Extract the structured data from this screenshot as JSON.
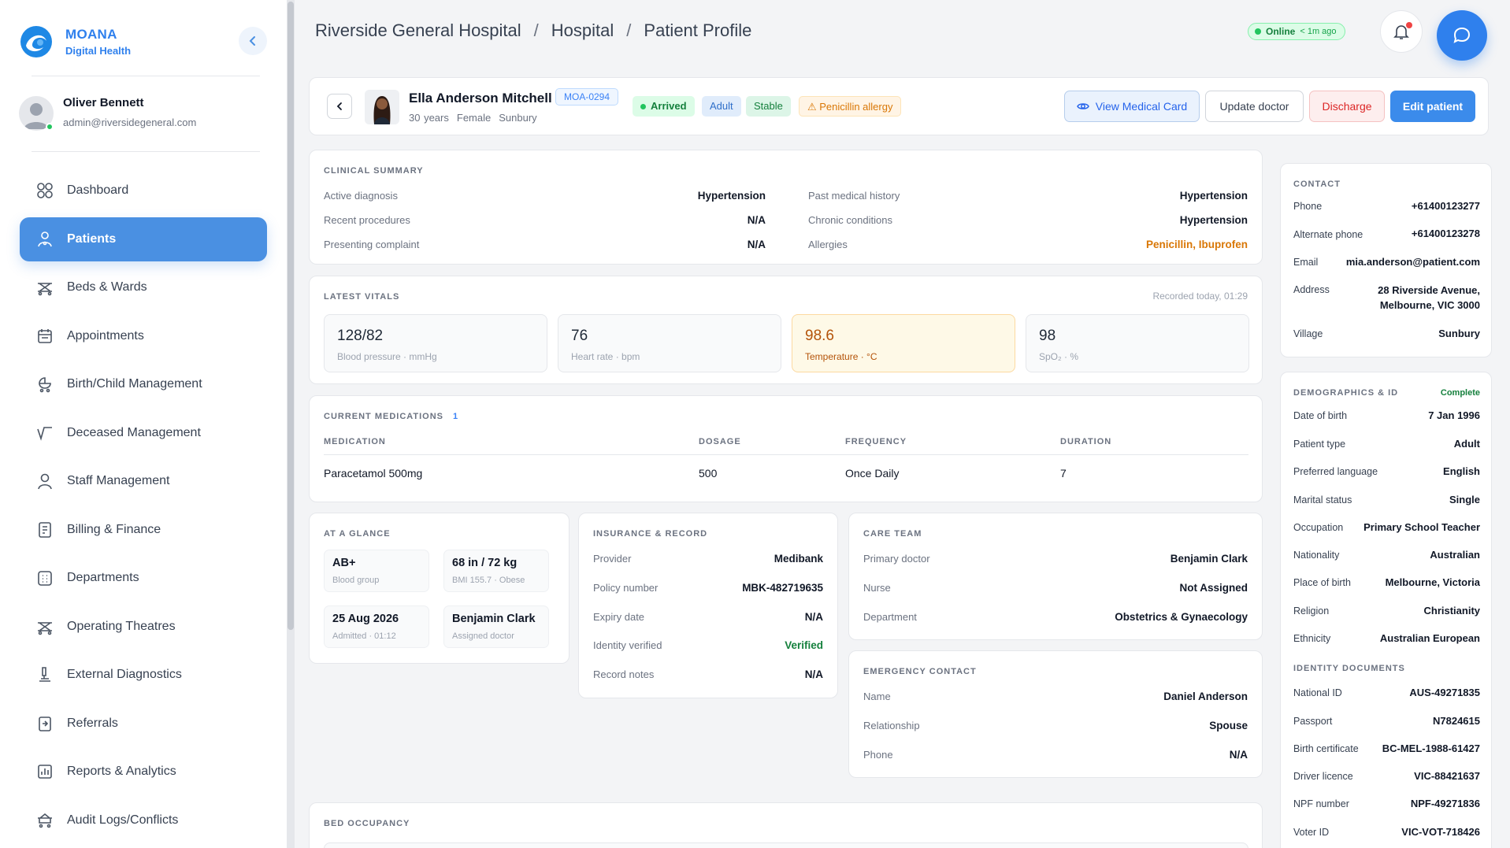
{
  "brand": {
    "name": "MOANA",
    "subtitle": "Digital Health"
  },
  "user": {
    "name": "Oliver Bennett",
    "email": "admin@riversidegeneral.com"
  },
  "nav": [
    {
      "label": "Dashboard",
      "icon": "dashboard-icon"
    },
    {
      "label": "Patients",
      "icon": "patients-icon",
      "active": true
    },
    {
      "label": "Beds & Wards",
      "icon": "bed-icon"
    },
    {
      "label": "Appointments",
      "icon": "calendar-icon"
    },
    {
      "label": "Birth/Child Management",
      "icon": "stroller-icon"
    },
    {
      "label": "Deceased Management",
      "icon": "pulse-icon"
    },
    {
      "label": "Staff Management",
      "icon": "staff-icon"
    },
    {
      "label": "Billing & Finance",
      "icon": "billing-icon"
    },
    {
      "label": "Departments",
      "icon": "building-icon"
    },
    {
      "label": "Operating Theatres",
      "icon": "theatre-icon"
    },
    {
      "label": "External Diagnostics",
      "icon": "microscope-icon"
    },
    {
      "label": "Referrals",
      "icon": "referral-icon"
    },
    {
      "label": "Reports & Analytics",
      "icon": "chart-icon"
    },
    {
      "label": "Audit Logs/Conflicts",
      "icon": "audit-icon"
    }
  ],
  "breadcrumb": [
    "Riverside General Hospital",
    "Hospital",
    "Patient Profile"
  ],
  "status": {
    "label": "Online",
    "ago": "< 1m ago"
  },
  "patient": {
    "name": "Ella Anderson Mitchell",
    "id": "MOA-0294",
    "age": "30 years",
    "sex": "Female",
    "village": "Sunbury",
    "tags": {
      "arrived": "Arrived",
      "type": "Adult",
      "condition": "Stable",
      "allergy": "⚠ Penicillin allergy"
    }
  },
  "actions": {
    "view": "View Medical Card",
    "update": "Update doctor",
    "discharge": "Discharge",
    "edit": "Edit patient"
  },
  "clinical": {
    "title": "CLINICAL SUMMARY",
    "rows": [
      {
        "label": "Active diagnosis",
        "value": "Hypertension"
      },
      {
        "label": "Recent procedures",
        "value": "N/A"
      },
      {
        "label": "Presenting complaint",
        "value": "N/A"
      },
      {
        "label": "Past medical history",
        "value": "Hypertension"
      },
      {
        "label": "Chronic conditions",
        "value": "Hypertension"
      },
      {
        "label": "Allergies",
        "value": "Penicillin, Ibuprofen"
      }
    ]
  },
  "vitals": {
    "title": "LATEST VITALS",
    "recorded": "Recorded today, 01:29",
    "items": [
      {
        "value": "128/82",
        "label": "Blood pressure · mmHg"
      },
      {
        "value": "76",
        "label": "Heart rate · bpm"
      },
      {
        "value": "98.6",
        "label": "Temperature · °C"
      },
      {
        "value": "98",
        "label": "SpO₂ · %"
      }
    ]
  },
  "medications": {
    "title": "CURRENT MEDICATIONS",
    "count": "1",
    "headers": [
      "MEDICATION",
      "DOSAGE",
      "FREQUENCY",
      "DURATION"
    ],
    "rows": [
      [
        "Paracetamol 500mg",
        "500",
        "Once Daily",
        "7"
      ]
    ]
  },
  "glance": {
    "title": "AT A GLANCE",
    "tiles": [
      {
        "value": "AB+",
        "label": "Blood group"
      },
      {
        "value": "68 in / 72 kg",
        "label": "BMI 155.7 · Obese"
      },
      {
        "value": "25 Aug 2026",
        "label": "Admitted · 01:12"
      },
      {
        "value": "Benjamin Clark",
        "label": "Assigned doctor"
      }
    ]
  },
  "insurance": {
    "title": "INSURANCE & RECORD",
    "rows": [
      {
        "label": "Provider",
        "value": "Medibank"
      },
      {
        "label": "Policy number",
        "value": "MBK-482719635"
      },
      {
        "label": "Expiry date",
        "value": "N/A"
      },
      {
        "label": "Identity verified",
        "value": "Verified"
      },
      {
        "label": "Record notes",
        "value": "N/A"
      }
    ]
  },
  "care": {
    "title": "CARE TEAM",
    "rows": [
      {
        "label": "Primary doctor",
        "value": "Benjamin Clark"
      },
      {
        "label": "Nurse",
        "value": "Not Assigned"
      },
      {
        "label": "Department",
        "value": "Obstetrics & Gynaecology"
      }
    ]
  },
  "emergency": {
    "title": "EMERGENCY CONTACT",
    "rows": [
      {
        "label": "Name",
        "value": "Daniel Anderson"
      },
      {
        "label": "Relationship",
        "value": "Spouse"
      },
      {
        "label": "Phone",
        "value": "N/A"
      }
    ]
  },
  "bed": {
    "title": "BED OCCUPANCY"
  },
  "contact": {
    "title": "CONTACT",
    "rows": [
      {
        "label": "Phone",
        "value": "+61400123277"
      },
      {
        "label": "Alternate phone",
        "value": "+61400123278"
      },
      {
        "label": "Email",
        "value": "mia.anderson@patient.com"
      },
      {
        "label": "Address",
        "value": "28 Riverside Avenue,",
        "value2": "Melbourne, VIC 3000"
      },
      {
        "label": "Village",
        "value": "Sunbury"
      }
    ]
  },
  "demographics": {
    "title": "DEMOGRAPHICS & ID",
    "status": "Complete",
    "rows": [
      {
        "label": "Date of birth",
        "value": "7 Jan 1996"
      },
      {
        "label": "Patient type",
        "value": "Adult"
      },
      {
        "label": "Preferred language",
        "value": "English"
      },
      {
        "label": "Marital status",
        "value": "Single"
      },
      {
        "label": "Occupation",
        "value": "Primary School Teacher"
      },
      {
        "label": "Nationality",
        "value": "Australian"
      },
      {
        "label": "Place of birth",
        "value": "Melbourne, Victoria"
      },
      {
        "label": "Religion",
        "value": "Christianity"
      },
      {
        "label": "Ethnicity",
        "value": "Australian European"
      }
    ],
    "id_title": "IDENTITY DOCUMENTS",
    "ids": [
      {
        "label": "National ID",
        "value": "AUS-49271835"
      },
      {
        "label": "Passport",
        "value": "N7824615"
      },
      {
        "label": "Birth certificate",
        "value": "BC-MEL-1988-61427"
      },
      {
        "label": "Driver licence",
        "value": "VIC-88421637"
      },
      {
        "label": "NPF number",
        "value": "NPF-49271836"
      },
      {
        "label": "Voter ID",
        "value": "VIC-VOT-718426"
      }
    ]
  },
  "colors": {
    "accent": "#4a90e2",
    "success": "#15803d",
    "danger": "#dc2626",
    "warning": "#d97706"
  }
}
